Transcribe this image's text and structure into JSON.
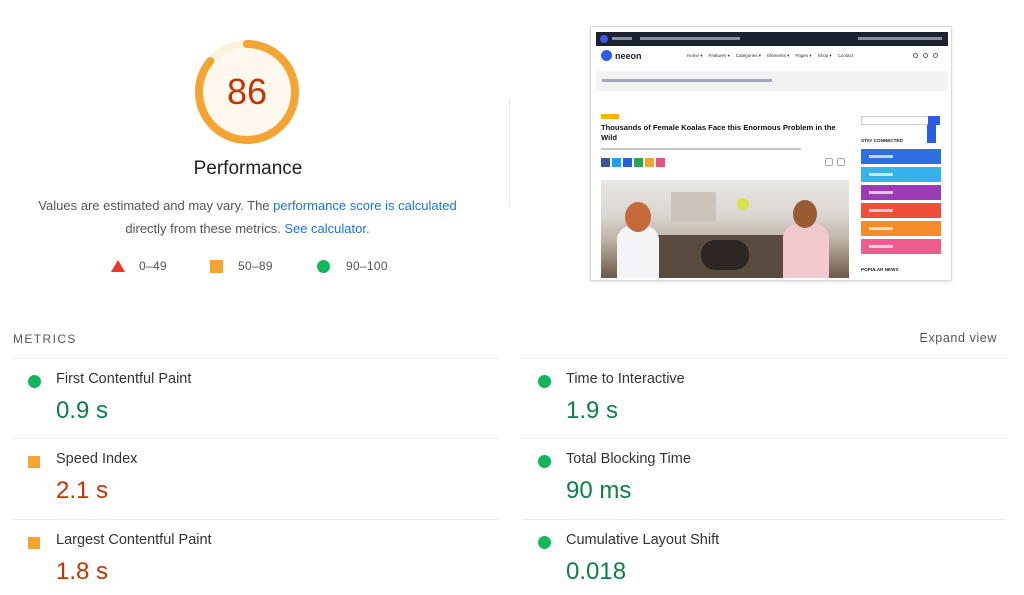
{
  "score": {
    "value": "86",
    "label": "Performance",
    "ring_color": "#f4a431",
    "track_color": "#fdf0dd",
    "text_color": "#c33300",
    "fraction": 0.86
  },
  "description": {
    "text_before": "Values are estimated and may vary. The ",
    "link1": "performance score is calculated",
    "text_middle": " directly from these metrics. ",
    "link2": "See calculator",
    "text_after": "."
  },
  "legend": [
    {
      "icon": "triangle-icon",
      "range": "0–49",
      "color": "#e8362d"
    },
    {
      "icon": "square-icon",
      "range": "50–89",
      "color": "#f4a431"
    },
    {
      "icon": "circle-icon",
      "range": "90–100",
      "color": "#12b65b"
    }
  ],
  "preview": {
    "logo": "neeon",
    "nav": [
      "Home ▾",
      "Features ▾",
      "Categories ▾",
      "Elements ▾",
      "Pages ▾",
      "Shop ▾",
      "Contact"
    ],
    "headline": "Thousands of Female Koalas Face this Enormous Problem in the Wild",
    "sidebar_heading": "STAY CONNECTED",
    "sidebar_heading_2": "POPULAR NEWS",
    "share_colors": [
      "#3b5998",
      "#1da1f2",
      "#2b5ce6",
      "#26a65b",
      "#f4a431",
      "#e75480"
    ],
    "social_colors": [
      "#2f6ee0",
      "#35b3ea",
      "#9b3bb6",
      "#ee4f3a",
      "#f68b2b",
      "#ef5d8f"
    ]
  },
  "metrics": {
    "title": "METRICS",
    "expand_label": "Expand view",
    "items": [
      {
        "label": "First Contentful Paint",
        "value": "0.9 s",
        "rating": "good"
      },
      {
        "label": "Time to Interactive",
        "value": "1.9 s",
        "rating": "good"
      },
      {
        "label": "Speed Index",
        "value": "2.1 s",
        "rating": "average"
      },
      {
        "label": "Total Blocking Time",
        "value": "90 ms",
        "rating": "good"
      },
      {
        "label": "Largest Contentful Paint",
        "value": "1.8 s",
        "rating": "average"
      },
      {
        "label": "Cumulative Layout Shift",
        "value": "0.018",
        "rating": "good"
      }
    ]
  }
}
